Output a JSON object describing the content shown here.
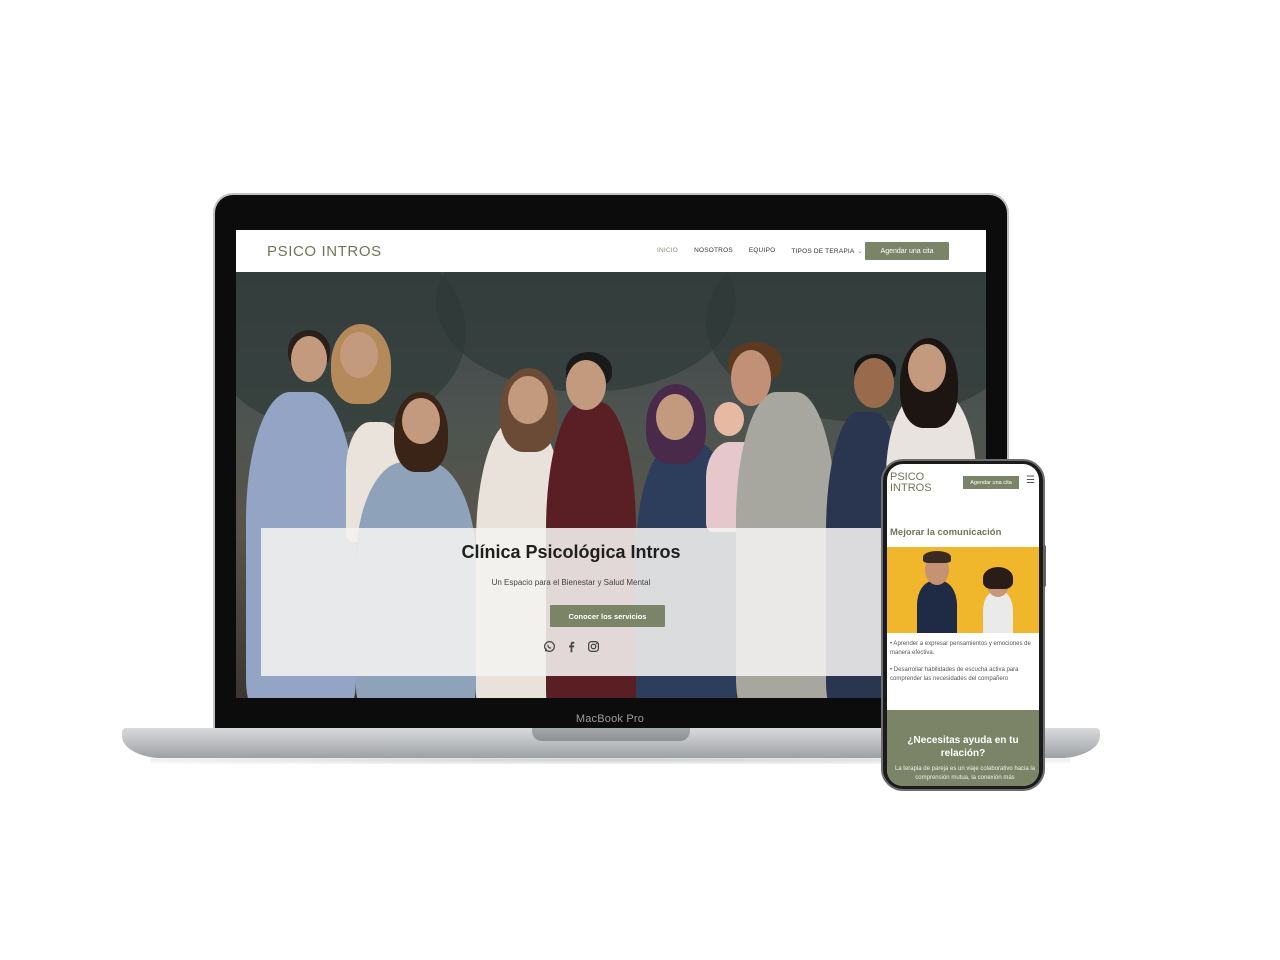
{
  "laptop": {
    "model_label": "MacBook Pro"
  },
  "desktop_site": {
    "logo": "PSICO INTROS",
    "nav": {
      "items": [
        "INICIO",
        "NOSOTROS",
        "EQUIPO",
        "TIPOS DE TERAPIA"
      ],
      "active": "INICIO",
      "dropdown_icon": "chevron-down-icon"
    },
    "cta_label": "Agendar una cita",
    "hero": {
      "title": "Clínica Psicológica Intros",
      "subtitle": "Un Espacio para el Bienestar y Salud Mental",
      "button_label": "Conocer los servicios",
      "social_icons": [
        "whatsapp-icon",
        "facebook-icon",
        "instagram-icon"
      ]
    }
  },
  "mobile_site": {
    "logo": "PSICO INTROS",
    "cta_label": "Agendar una cita",
    "menu_icon": "hamburger-icon",
    "section_heading": "Mejorar la comunicación",
    "bullets": [
      "• Aprender a expresar pensamientos y emociones de manera efectiva.",
      "• Desarrollar habilidades de escucha activa para comprender las necesidades del compañero"
    ],
    "band": {
      "heading": "¿Necesitas ayuda en tu relación?",
      "text": "La terapia de pareja es un viaje colaborativo hacia la comprensión mutua, la conexión más"
    }
  },
  "colors": {
    "brand_olive": "#7c8467",
    "logo_text": "#6f7658",
    "mobile_image_bg": "#f0b62c"
  }
}
